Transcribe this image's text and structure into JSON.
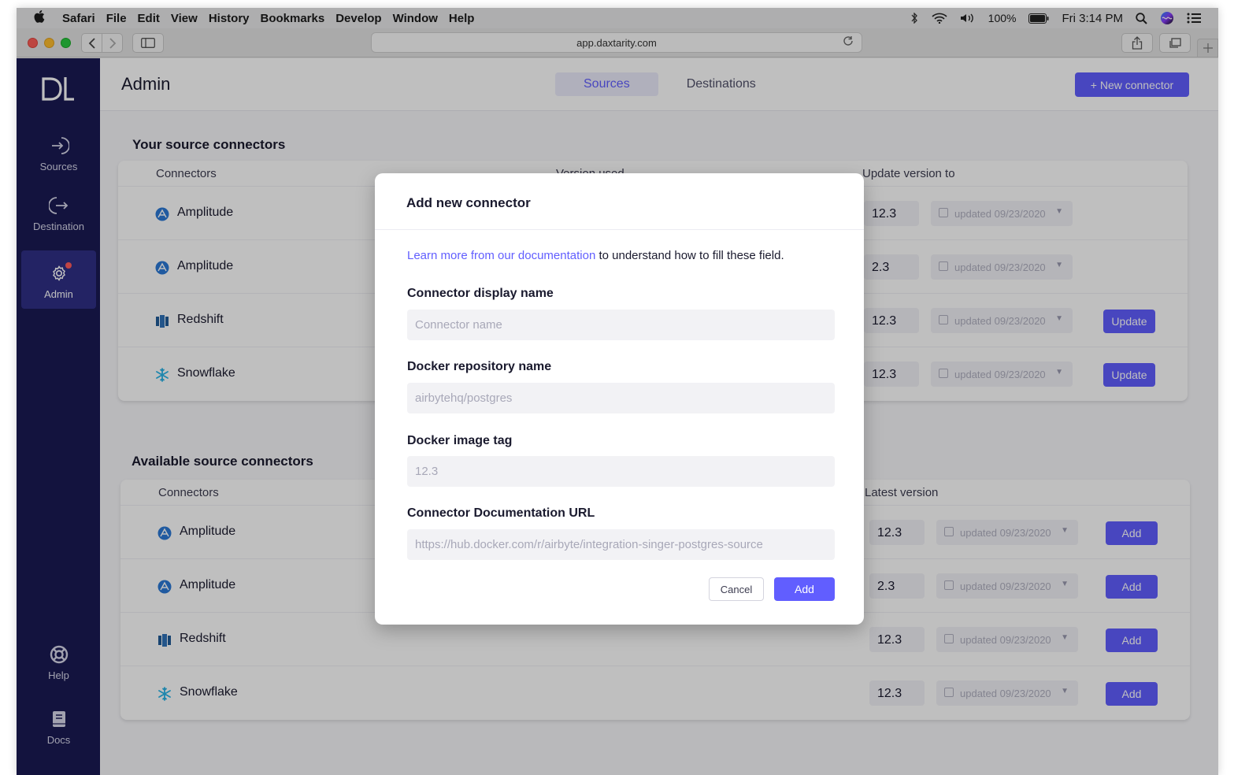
{
  "menubar": {
    "items": [
      "Safari",
      "File",
      "Edit",
      "View",
      "History",
      "Bookmarks",
      "Develop",
      "Window",
      "Help"
    ],
    "battery": "100%",
    "clock": "Fri 3:14 PM"
  },
  "browser": {
    "url": "app.daxtarity.com"
  },
  "sidebar": {
    "logo": "DL",
    "items": [
      {
        "label": "Sources",
        "icon": "sign-in-icon"
      },
      {
        "label": "Destination",
        "icon": "sign-out-icon"
      },
      {
        "label": "Admin",
        "icon": "gear-icon",
        "active": true
      },
      {
        "label": "Help",
        "icon": "lifebuoy-icon"
      },
      {
        "label": "Docs",
        "icon": "book-icon"
      }
    ]
  },
  "header": {
    "title": "Admin",
    "tabs": [
      {
        "label": "Sources",
        "active": true
      },
      {
        "label": "Destinations",
        "active": false
      }
    ],
    "new_connector": "+ New connector"
  },
  "your_connectors": {
    "title": "Your source connectors",
    "columns": [
      "Connectors",
      "Version used",
      "Update version to"
    ],
    "rows": [
      {
        "name": "Amplitude",
        "icon": "amplitude-icon",
        "version": "12.3",
        "date": "updated 09/23/2020",
        "action": ""
      },
      {
        "name": "Amplitude",
        "icon": "amplitude-icon",
        "version": "2.3",
        "date": "updated 09/23/2020",
        "action": ""
      },
      {
        "name": "Redshift",
        "icon": "redshift-icon",
        "version": "12.3",
        "date": "updated 09/23/2020",
        "action": "Update"
      },
      {
        "name": "Snowflake",
        "icon": "snowflake-icon",
        "version": "12.3",
        "date": "updated 09/23/2020",
        "action": "Update"
      }
    ]
  },
  "available_connectors": {
    "title": "Available source connectors",
    "columns": [
      "Connectors",
      "Latest version"
    ],
    "rows": [
      {
        "name": "Amplitude",
        "icon": "amplitude-icon",
        "version": "12.3",
        "date": "updated 09/23/2020",
        "action": "Add"
      },
      {
        "name": "Amplitude",
        "icon": "amplitude-icon",
        "version": "2.3",
        "date": "updated 09/23/2020",
        "action": "Add"
      },
      {
        "name": "Redshift",
        "icon": "redshift-icon",
        "version": "12.3",
        "date": "updated 09/23/2020",
        "action": "Add"
      },
      {
        "name": "Snowflake",
        "icon": "snowflake-icon",
        "version": "12.3",
        "date": "updated 09/23/2020",
        "action": "Add"
      }
    ]
  },
  "modal": {
    "title": "Add new connector",
    "intro_link": "Learn more from our documentation",
    "intro_rest": " to understand how to fill these field.",
    "fields": [
      {
        "label": "Connector display name",
        "placeholder": "Connector name",
        "value": ""
      },
      {
        "label": "Docker repository name",
        "placeholder": "airbytehq/postgres",
        "value": ""
      },
      {
        "label": "Docker image tag",
        "placeholder": "12.3",
        "value": ""
      },
      {
        "label": "Connector Documentation URL",
        "placeholder": "https://hub.docker.com/r/airbyte/integration-singer-postgres-source",
        "value": ""
      }
    ],
    "cancel": "Cancel",
    "add": "Add"
  },
  "colors": {
    "accent": "#615eff",
    "sidebar": "#1a1a53",
    "sidebar_active": "#2f2f86",
    "badge": "#ff5b5b"
  }
}
